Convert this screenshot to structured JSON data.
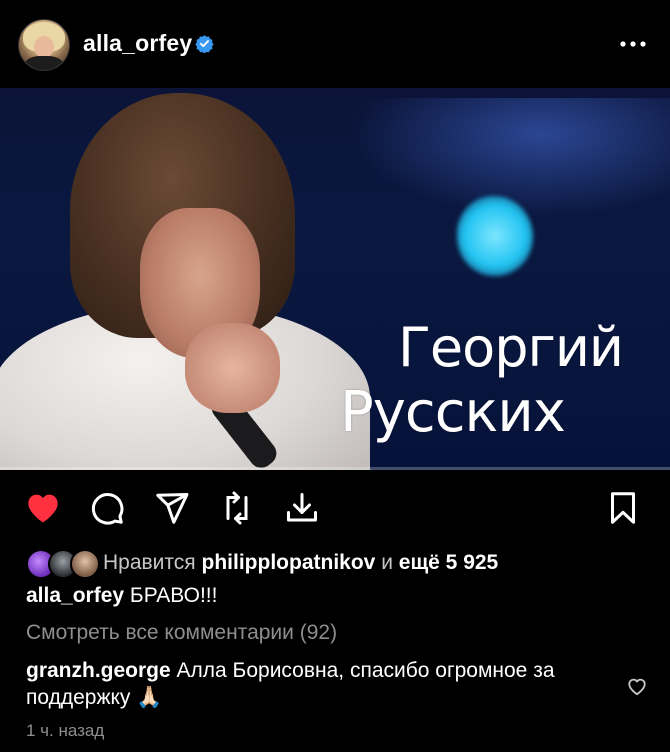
{
  "post": {
    "username": "alla_orfey",
    "verified": true
  },
  "media": {
    "overlay_line1": "Георгий",
    "overlay_line2": "Русских",
    "progress": 0.0
  },
  "icons": {
    "like": "heart-filled-icon",
    "comment": "comment-icon",
    "share": "send-icon",
    "repost": "repost-icon",
    "download": "download-icon",
    "save": "bookmark-icon",
    "more": "more-horizontal-icon",
    "verified": "verified-badge-icon"
  },
  "colors": {
    "background": "#000000",
    "like_red": "#ff3040",
    "verified_blue": "#3897f0",
    "muted_text": "#8e8e8e"
  },
  "likes": {
    "prefix": "Нравится",
    "liked_by": "philipplopatnikov",
    "connector": "и",
    "others": "ещё 5 925"
  },
  "caption": {
    "username": "alla_orfey",
    "text": "БРАВО!!!"
  },
  "view_comments": "Смотреть все комментарии (92)",
  "comment": {
    "username": "granzh.george",
    "text": "Алла Борисовна, спасибо огромное за поддержку 🙏🏻"
  },
  "timestamp": "1 ч. назад"
}
